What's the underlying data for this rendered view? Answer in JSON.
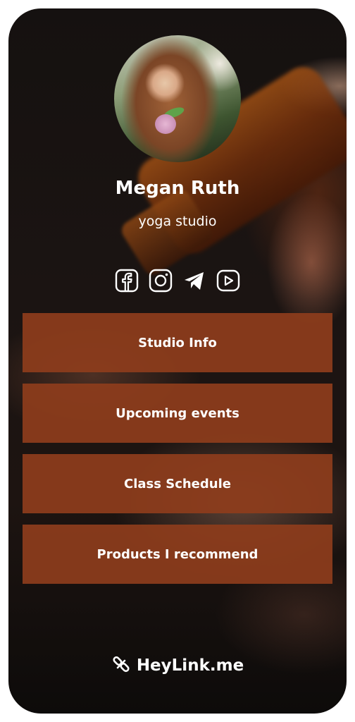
{
  "profile": {
    "name": "Megan Ruth",
    "subtitle": "yoga studio"
  },
  "socials": [
    {
      "icon": "facebook-icon"
    },
    {
      "icon": "instagram-icon"
    },
    {
      "icon": "telegram-icon"
    },
    {
      "icon": "youtube-icon"
    }
  ],
  "links": [
    {
      "label": "Studio Info"
    },
    {
      "label": "Upcoming events"
    },
    {
      "label": "Class Schedule"
    },
    {
      "label": "Products I recommend"
    }
  ],
  "footer": {
    "brand": "HeyLink.me",
    "logo_icon": "heylink-logo-icon"
  },
  "colors": {
    "button_bg": "#8d3c1c",
    "text": "#ffffff"
  }
}
